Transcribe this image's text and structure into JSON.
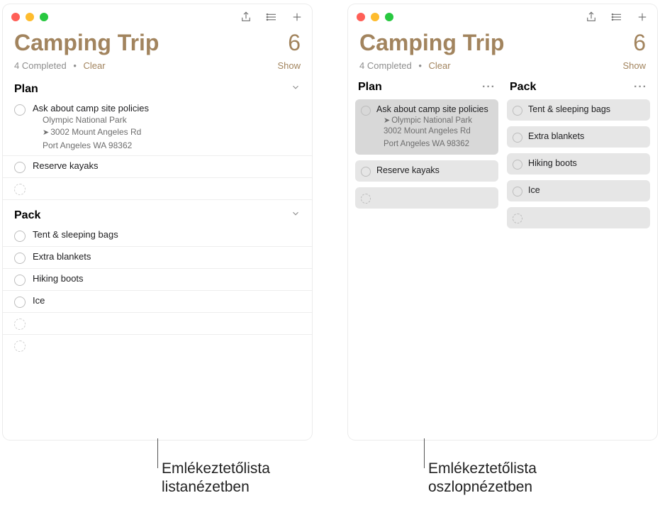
{
  "accent": "#a2845e",
  "left": {
    "title": "Camping Trip",
    "count": "6",
    "completed_text": "4 Completed",
    "clear_label": "Clear",
    "show_label": "Show",
    "sections": [
      {
        "name": "Plan",
        "items": [
          {
            "title": "Ask about camp site policies",
            "subtitle": "Olympic National Park",
            "address1": "3002 Mount Angeles Rd",
            "address2": "Port Angeles WA 98362"
          },
          {
            "title": "Reserve kayaks"
          }
        ]
      },
      {
        "name": "Pack",
        "items": [
          {
            "title": "Tent & sleeping bags"
          },
          {
            "title": "Extra blankets"
          },
          {
            "title": "Hiking boots"
          },
          {
            "title": "Ice"
          }
        ]
      }
    ]
  },
  "right": {
    "title": "Camping Trip",
    "count": "6",
    "completed_text": "4 Completed",
    "clear_label": "Clear",
    "show_label": "Show",
    "columns": [
      {
        "name": "Plan",
        "items": [
          {
            "title": "Ask about camp site policies",
            "subtitle": "Olympic National Park",
            "address1": "3002 Mount Angeles Rd",
            "address2": "Port Angeles WA 98362",
            "selected": true
          },
          {
            "title": "Reserve kayaks"
          }
        ]
      },
      {
        "name": "Pack",
        "items": [
          {
            "title": "Tent & sleeping bags"
          },
          {
            "title": "Extra blankets"
          },
          {
            "title": "Hiking boots"
          },
          {
            "title": "Ice"
          }
        ]
      }
    ]
  },
  "captions": {
    "left_line1": "Emlékeztetőlista",
    "left_line2": "listanézetben",
    "right_line1": "Emlékeztetőlista",
    "right_line2": "oszlopnézetben"
  }
}
